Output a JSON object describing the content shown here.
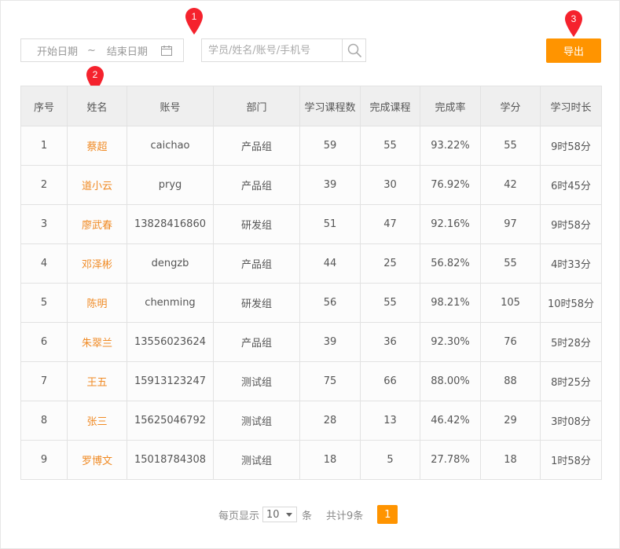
{
  "filters": {
    "start_date_placeholder": "开始日期",
    "separator": "~",
    "end_date_placeholder": "结束日期",
    "search_placeholder": "学员/姓名/账号/手机号"
  },
  "toolbar": {
    "export_label": "导出"
  },
  "markers": [
    "1",
    "2",
    "3"
  ],
  "colors": {
    "accent": "#ff9400",
    "marker": "#f5222d",
    "name_link": "#f08a24",
    "header_bg": "#efefef"
  },
  "table": {
    "headers": [
      "序号",
      "姓名",
      "账号",
      "部门",
      "学习课程数",
      "完成课程",
      "完成率",
      "学分",
      "学习时长"
    ],
    "rows": [
      [
        "1",
        "蔡超",
        "caichao",
        "产品组",
        "59",
        "55",
        "93.22%",
        "55",
        "9时58分"
      ],
      [
        "2",
        "道小云",
        "pryg",
        "产品组",
        "39",
        "30",
        "76.92%",
        "42",
        "6时45分"
      ],
      [
        "3",
        "廖武春",
        "13828416860",
        "研发组",
        "51",
        "47",
        "92.16%",
        "97",
        "9时58分"
      ],
      [
        "4",
        "邓泽彬",
        "dengzb",
        "产品组",
        "44",
        "25",
        "56.82%",
        "55",
        "4时33分"
      ],
      [
        "5",
        "陈明",
        "chenming",
        "研发组",
        "56",
        "55",
        "98.21%",
        "105",
        "10时58分"
      ],
      [
        "6",
        "朱翠兰",
        "13556023624",
        "产品组",
        "39",
        "36",
        "92.30%",
        "76",
        "5时28分"
      ],
      [
        "7",
        "王五",
        "15913123247",
        "测试组",
        "75",
        "66",
        "88.00%",
        "88",
        "8时25分"
      ],
      [
        "8",
        "张三",
        "15625046792",
        "测试组",
        "28",
        "13",
        "46.42%",
        "29",
        "3时08分"
      ],
      [
        "9",
        "罗博文",
        "15018784308",
        "测试组",
        "18",
        "5",
        "27.78%",
        "18",
        "1时58分"
      ]
    ]
  },
  "pagination": {
    "per_page_label": "每页显示",
    "per_page_value": "10",
    "unit_label": "条",
    "total_label": "共计9条",
    "current_page": "1"
  }
}
